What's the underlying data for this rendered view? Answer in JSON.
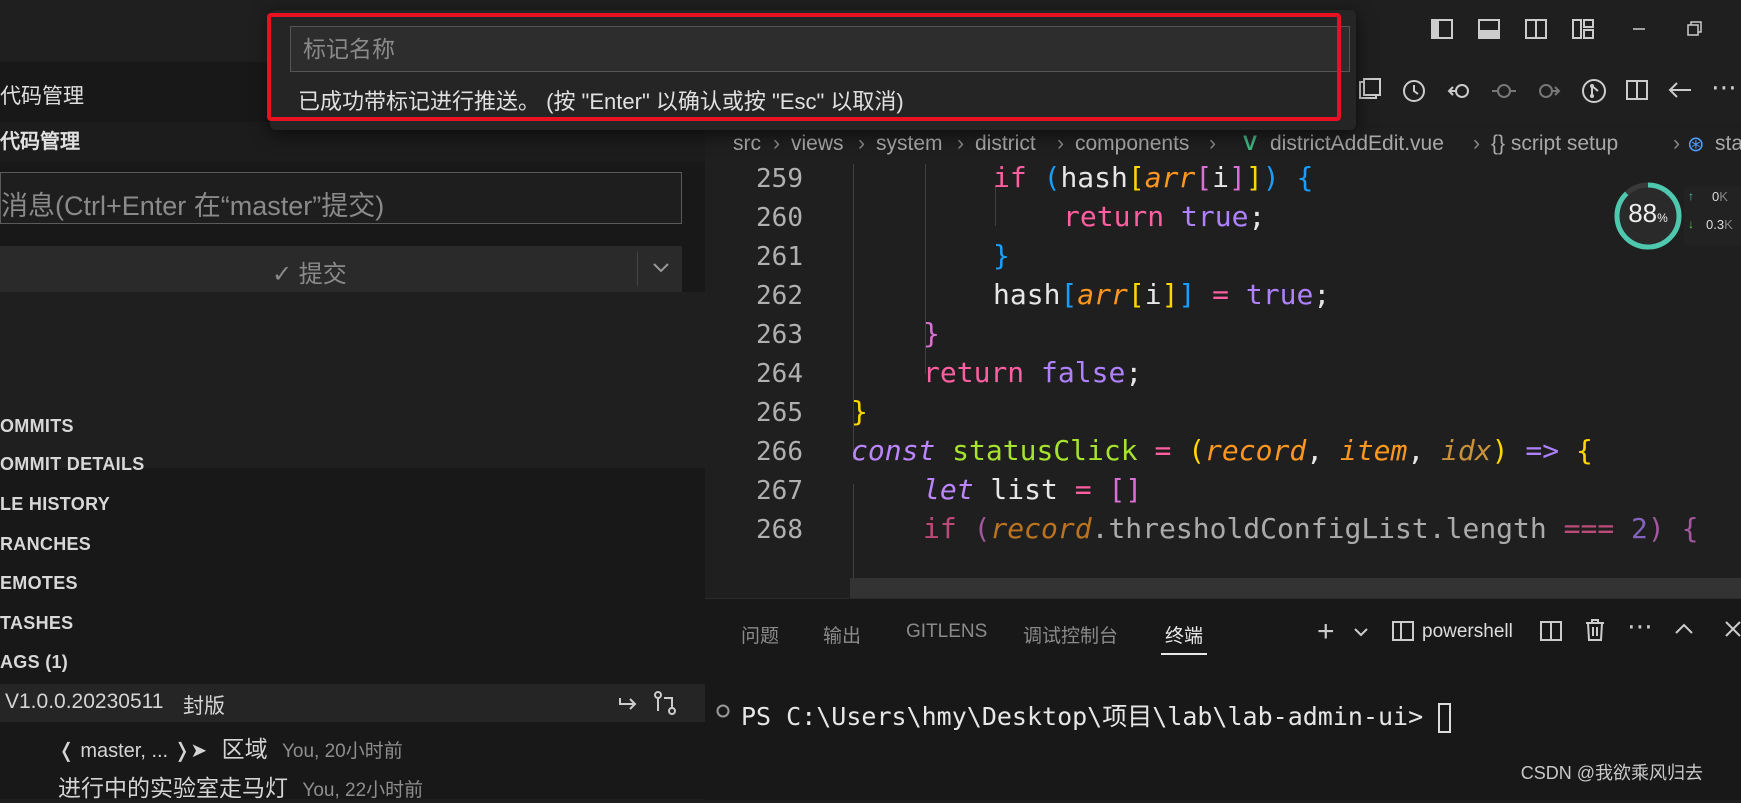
{
  "overlay": {
    "placeholder": "标记名称",
    "message": "已成功带标记进行推送。 (按 \"Enter\" 以确认或按 \"Esc\" 以取消)"
  },
  "scm": {
    "header_title": "代码管理",
    "section_title": "代码管理",
    "commit_placeholder": "消息(Ctrl+Enter 在“master”提交)",
    "commit_button": "提交",
    "sections": [
      "OMMITS",
      "OMMIT DETAILS",
      "LE HISTORY",
      "RANCHES",
      "EMOTES",
      "TASHES",
      "AGS (1)"
    ],
    "tag_label": "V1.0.0.20230511",
    "tag_note": "封版",
    "commits": [
      {
        "prefix": "❬ master, ... ❭➤",
        "message": "区域",
        "meta": "You, 20小时前"
      },
      {
        "prefix": "",
        "message": "进行中的实验室走马灯",
        "meta": "You, 22小时前"
      }
    ]
  },
  "breadcrumb": {
    "items": [
      "src",
      "views",
      "system",
      "district",
      "components",
      "districtAddEdit.vue",
      "{} script setup",
      "sta"
    ]
  },
  "editor": {
    "line_numbers": [
      "259",
      "260",
      "261",
      "262",
      "263",
      "264",
      "265",
      "266",
      "267",
      "268"
    ]
  },
  "panel": {
    "tabs": [
      "问题",
      "输出",
      "GITLENS",
      "调试控制台",
      "终端"
    ],
    "active_tab": "终端",
    "shell": "powershell",
    "prompt": "PS C:\\Users\\hmy\\Desktop\\项目\\lab\\lab-admin-ui> "
  },
  "gauge": {
    "percent": "88",
    "unit": "%",
    "up": "0",
    "down": "0.3",
    "rate_unit": "K"
  },
  "watermark": "CSDN @我欲乘风归去",
  "colors": {
    "highlight": "#e81123",
    "accent": "#4ec9b0"
  }
}
